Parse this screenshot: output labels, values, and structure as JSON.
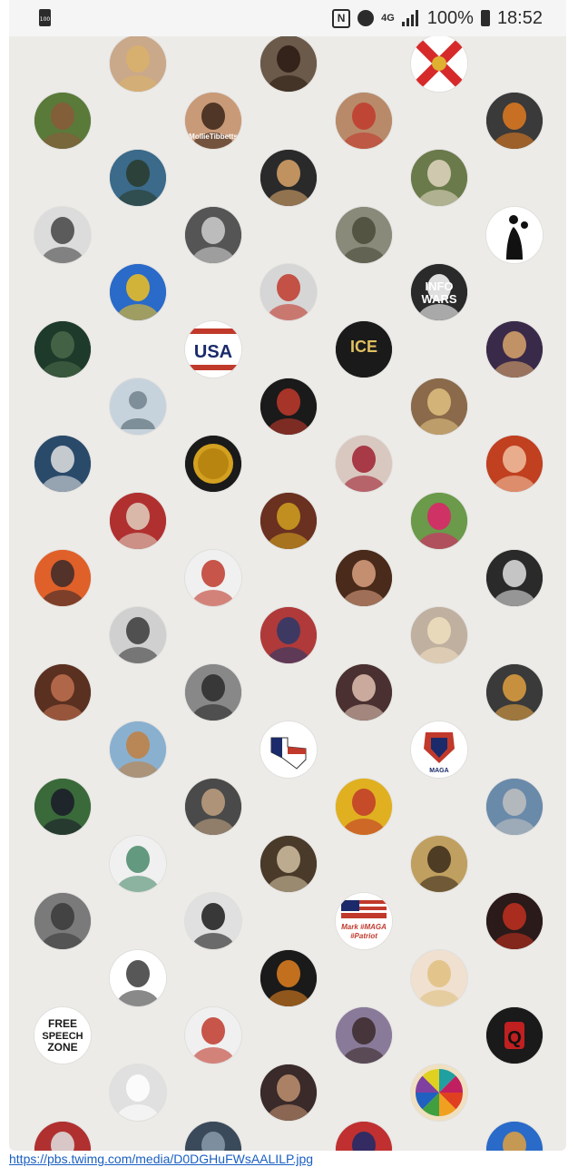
{
  "status_bar": {
    "battery_small_label": "100",
    "lte_label": "4G",
    "battery_percent": "100%",
    "time": "18:52"
  },
  "avatars": [
    {
      "name": "avatar-partial-1",
      "col": 0,
      "row": -1,
      "bg": "#3a3a3a",
      "fg": "#111"
    },
    {
      "name": "avatar-partial-2",
      "col": 2,
      "row": -1,
      "bg": "#c23b2a",
      "fg": "#8a2010"
    },
    {
      "name": "avatar-partial-3",
      "col": 4,
      "row": -1,
      "bg": "#2a2a2a",
      "fg": "#111"
    },
    {
      "name": "avatar-partial-4",
      "col": 6,
      "row": -1,
      "bg": "#333",
      "fg": "#111"
    },
    {
      "name": "avatar-blonde-woman",
      "col": 1,
      "row": 0,
      "bg": "#caa88a",
      "fg": "#d9b26a"
    },
    {
      "name": "avatar-dark-hair-woman",
      "col": 3,
      "row": 0,
      "bg": "#6b5a4a",
      "fg": "#2a1a12"
    },
    {
      "name": "avatar-florida-flag",
      "col": 5,
      "row": 0,
      "bg": "#ffffff",
      "fg": "#d62a2a",
      "type": "cross"
    },
    {
      "name": "avatar-garden",
      "col": 0,
      "row": 1,
      "bg": "#5a7a3a",
      "fg": "#8a5a3a"
    },
    {
      "name": "avatar-mollie-tibbetts",
      "col": 2,
      "row": 1,
      "bg": "#c99a78",
      "fg": "#3a2418",
      "caption": "MollieTibbetts"
    },
    {
      "name": "avatar-hat-woman",
      "col": 4,
      "row": 1,
      "bg": "#b88a6a",
      "fg": "#c0392b"
    },
    {
      "name": "avatar-cartoon-fox",
      "col": 6,
      "row": 1,
      "bg": "#3a3a3a",
      "fg": "#e07a20"
    },
    {
      "name": "avatar-statue",
      "col": 1,
      "row": 2,
      "bg": "#3b6a8a",
      "fg": "#2a3a2a"
    },
    {
      "name": "avatar-redhead-woman",
      "col": 3,
      "row": 2,
      "bg": "#2a2a2a",
      "fg": "#d9a56a"
    },
    {
      "name": "avatar-cowboy-hat-man",
      "col": 5,
      "row": 2,
      "bg": "#6a7a4a",
      "fg": "#e0d6c0"
    },
    {
      "name": "avatar-bw-woman",
      "col": 0,
      "row": 3,
      "bg": "#dcdcdc",
      "fg": "#444"
    },
    {
      "name": "avatar-bw-boy",
      "col": 2,
      "row": 3,
      "bg": "#555",
      "fg": "#cfcfcf"
    },
    {
      "name": "avatar-soldier",
      "col": 4,
      "row": 3,
      "bg": "#8a8a7a",
      "fg": "#4a4a3a"
    },
    {
      "name": "avatar-silhouette-child",
      "col": 6,
      "row": 3,
      "bg": "#ffffff",
      "fg": "#111",
      "type": "silhouette"
    },
    {
      "name": "avatar-colorful-art",
      "col": 1,
      "row": 4,
      "bg": "#2a6ac8",
      "fg": "#f0c020"
    },
    {
      "name": "avatar-red-cap-man",
      "col": 3,
      "row": 4,
      "bg": "#d6d6d6",
      "fg": "#c0392b"
    },
    {
      "name": "avatar-infowars",
      "col": 5,
      "row": 4,
      "bg": "#2a2a2a",
      "fg": "#ffffff",
      "caption": "INFO WARS"
    },
    {
      "name": "avatar-matrix-man",
      "col": 0,
      "row": 5,
      "bg": "#1e3a2a",
      "fg": "#4a6a4a"
    },
    {
      "name": "avatar-usa",
      "col": 2,
      "row": 5,
      "bg": "#ffffff",
      "fg": "#c0392b",
      "caption": "USA",
      "type": "usa"
    },
    {
      "name": "avatar-ice",
      "col": 4,
      "row": 5,
      "bg": "#1a1a1a",
      "fg": "#e0c060",
      "caption": "ICE"
    },
    {
      "name": "avatar-flower-crown-woman",
      "col": 6,
      "row": 5,
      "bg": "#3a2a4a",
      "fg": "#d9a56a"
    },
    {
      "name": "avatar-default-user",
      "col": 1,
      "row": 6,
      "bg": "#c7d3dc",
      "fg": "#7f8f99",
      "type": "default"
    },
    {
      "name": "avatar-suit-man",
      "col": 3,
      "row": 6,
      "bg": "#1a1a1a",
      "fg": "#c0392b"
    },
    {
      "name": "avatar-blonde-selfie",
      "col": 5,
      "row": 6,
      "bg": "#8a6a4a",
      "fg": "#e0c080"
    },
    {
      "name": "avatar-assassin-logo",
      "col": 0,
      "row": 7,
      "bg": "#2a4a6a",
      "fg": "#e0e0e0"
    },
    {
      "name": "avatar-gold-coin",
      "col": 2,
      "row": 7,
      "bg": "#1a1a1a",
      "fg": "#d4a020",
      "type": "coin"
    },
    {
      "name": "avatar-flag-heels",
      "col": 4,
      "row": 7,
      "bg": "#d8c8c0",
      "fg": "#a02030"
    },
    {
      "name": "avatar-red-dress-woman",
      "col": 6,
      "row": 7,
      "bg": "#c04020",
      "fg": "#f0c0a0"
    },
    {
      "name": "avatar-flag-glasses-man",
      "col": 1,
      "row": 8,
      "bg": "#b03030",
      "fg": "#e0d0c0"
    },
    {
      "name": "avatar-cross-flag",
      "col": 3,
      "row": 8,
      "bg": "#6a3020",
      "fg": "#d0a020"
    },
    {
      "name": "avatar-flowers-woman",
      "col": 5,
      "row": 8,
      "bg": "#6a9a4a",
      "fg": "#e0206a"
    },
    {
      "name": "avatar-sunset",
      "col": 0,
      "row": 9,
      "bg": "#e0602a",
      "fg": "#3a2a2a"
    },
    {
      "name": "avatar-trump-thumbs",
      "col": 2,
      "row": 9,
      "bg": "#f0f0f0",
      "fg": "#c0392b"
    },
    {
      "name": "avatar-brunette-woman",
      "col": 4,
      "row": 9,
      "bg": "#4a2a1a",
      "fg": "#d9a080"
    },
    {
      "name": "avatar-bw-smiling-woman",
      "col": 6,
      "row": 9,
      "bg": "#2a2a2a",
      "fg": "#e0e0e0"
    },
    {
      "name": "avatar-bw-portrait",
      "col": 1,
      "row": 10,
      "bg": "#d0d0d0",
      "fg": "#3a3a3a"
    },
    {
      "name": "avatar-flag-man-sunglasses",
      "col": 3,
      "row": 10,
      "bg": "#b03a3a",
      "fg": "#2a3a6a"
    },
    {
      "name": "avatar-platinum-woman",
      "col": 5,
      "row": 10,
      "bg": "#c0b0a0",
      "fg": "#f0e0c0"
    },
    {
      "name": "avatar-curly-hair-woman",
      "col": 0,
      "row": 11,
      "bg": "#5a3020",
      "fg": "#c07050"
    },
    {
      "name": "avatar-bw-woman-2",
      "col": 2,
      "row": 11,
      "bg": "#888",
      "fg": "#2a2a2a"
    },
    {
      "name": "avatar-glasses-woman",
      "col": 4,
      "row": 11,
      "bg": "#4a3030",
      "fg": "#e0c0b0"
    },
    {
      "name": "avatar-lion-face-paint",
      "col": 6,
      "row": 11,
      "bg": "#3a3a3a",
      "fg": "#e0a040"
    },
    {
      "name": "avatar-long-hair-woman",
      "col": 1,
      "row": 12,
      "bg": "#8ab0d0",
      "fg": "#c08040"
    },
    {
      "name": "avatar-texas-flag",
      "col": 3,
      "row": 12,
      "bg": "#ffffff",
      "fg": "#1a2a6a",
      "type": "texas"
    },
    {
      "name": "avatar-maga-lion",
      "col": 5,
      "row": 12,
      "bg": "#ffffff",
      "fg": "#c0392b",
      "caption": "MAGA",
      "type": "maga"
    },
    {
      "name": "avatar-motorcycle",
      "col": 0,
      "row": 13,
      "bg": "#3a6a3a",
      "fg": "#1a1a2a"
    },
    {
      "name": "avatar-sunglasses-man",
      "col": 2,
      "row": 13,
      "bg": "#4a4a4a",
      "fg": "#c0a080"
    },
    {
      "name": "avatar-cartoon-red-cap",
      "col": 4,
      "row": 13,
      "bg": "#e0b020",
      "fg": "#c0392b"
    },
    {
      "name": "avatar-airport",
      "col": 6,
      "row": 13,
      "bg": "#6a8aaa",
      "fg": "#c0c0c0"
    },
    {
      "name": "avatar-liberty-statues",
      "col": 1,
      "row": 14,
      "bg": "#f0f0f0",
      "fg": "#4a8a6a"
    },
    {
      "name": "avatar-cat",
      "col": 3,
      "row": 14,
      "bg": "#4a3a2a",
      "fg": "#d0c0a0"
    },
    {
      "name": "avatar-leopard",
      "col": 5,
      "row": 14,
      "bg": "#c0a060",
      "fg": "#3a2a1a"
    },
    {
      "name": "avatar-bw-soldier",
      "col": 0,
      "row": 15,
      "bg": "#7a7a7a",
      "fg": "#3a3a3a"
    },
    {
      "name": "avatar-bw-actor",
      "col": 2,
      "row": 15,
      "bg": "#e0e0e0",
      "fg": "#1a1a1a"
    },
    {
      "name": "avatar-mark-maga-patriot",
      "col": 4,
      "row": 15,
      "bg": "#ffffff",
      "fg": "#c0392b",
      "caption": "Mark #MAGA #Patriot",
      "type": "flagtext"
    },
    {
      "name": "avatar-vlad",
      "col": 6,
      "row": 15,
      "bg": "#2a1a1a",
      "fg": "#c03020"
    },
    {
      "name": "avatar-spartan",
      "col": 1,
      "row": 16,
      "bg": "#ffffff",
      "fg": "#3a3a3a"
    },
    {
      "name": "avatar-pumpkin",
      "col": 3,
      "row": 16,
      "bg": "#1a1a1a",
      "fg": "#e08020"
    },
    {
      "name": "avatar-cartoon-blonde",
      "col": 5,
      "row": 16,
      "bg": "#f0e0d0",
      "fg": "#e0c080"
    },
    {
      "name": "avatar-free-speech-zone",
      "col": 0,
      "row": 17,
      "bg": "#ffffff",
      "fg": "#1a1a1a",
      "caption": "FREE SPEECH ZONE",
      "type": "text"
    },
    {
      "name": "avatar-trump-portrait",
      "col": 2,
      "row": 17,
      "bg": "#f0f0f0",
      "fg": "#c0392b"
    },
    {
      "name": "avatar-selfie-woman",
      "col": 4,
      "row": 17,
      "bg": "#8a7a9a",
      "fg": "#3a2a2a"
    },
    {
      "name": "avatar-q-logo",
      "col": 6,
      "row": 17,
      "bg": "#1a1a1a",
      "fg": "#c02020",
      "caption": "Q",
      "type": "q"
    },
    {
      "name": "avatar-white-rabbit",
      "col": 1,
      "row": 18,
      "bg": "#e0e0e0",
      "fg": "#ffffff"
    },
    {
      "name": "avatar-woman-car",
      "col": 3,
      "row": 18,
      "bg": "#3a2a2a",
      "fg": "#c09070"
    },
    {
      "name": "avatar-color-wheel",
      "col": 5,
      "row": 18,
      "bg": "#f0e0c0",
      "fg": "#e06020",
      "type": "wheel"
    },
    {
      "name": "avatar-bottom-1",
      "col": 0,
      "row": 19,
      "bg": "#b03030",
      "fg": "#e0e0e0"
    },
    {
      "name": "avatar-bottom-2",
      "col": 2,
      "row": 19,
      "bg": "#3a4a5a",
      "fg": "#8a9aaa"
    },
    {
      "name": "avatar-bottom-3",
      "col": 4,
      "row": 19,
      "bg": "#c03030",
      "fg": "#1a2a6a"
    },
    {
      "name": "avatar-bottom-4",
      "col": 6,
      "row": 19,
      "bg": "#2a6ac8",
      "fg": "#e0a040"
    }
  ],
  "footer": {
    "link_text": "https://pbs.twimg.com/media/D0DGHuFWsAALILP.jpg"
  }
}
